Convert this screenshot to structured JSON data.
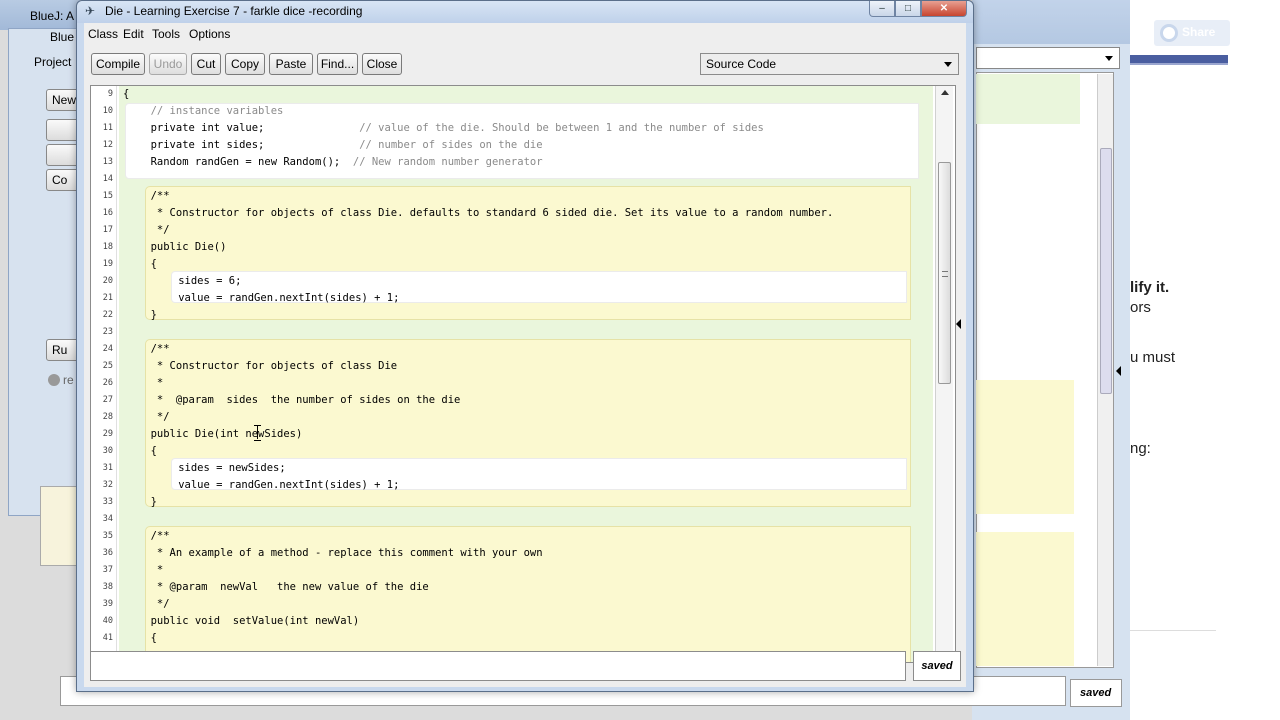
{
  "background": {
    "bluej_title_1": "BlueJ: A",
    "bluej_title_2": "Blue",
    "project_menu": "Project",
    "buttons": [
      "New",
      "Co",
      "Ru"
    ],
    "radio_label": "re",
    "right_saved": "saved",
    "browser": {
      "share_label": "Share",
      "text_lines": [
        "lify it.",
        "ors",
        "u must",
        "ng:"
      ]
    }
  },
  "window": {
    "title": "Die - Learning Exercise 7 - farkle dice -recording",
    "controls": {
      "minimize": "–",
      "maximize": "□",
      "close": "✕"
    }
  },
  "menu": [
    "Class",
    "Edit",
    "Tools",
    "Options"
  ],
  "toolbar": {
    "buttons": [
      {
        "label": "Compile",
        "enabled": true
      },
      {
        "label": "Undo",
        "enabled": false
      },
      {
        "label": "Cut",
        "enabled": true
      },
      {
        "label": "Copy",
        "enabled": true
      },
      {
        "label": "Paste",
        "enabled": true
      },
      {
        "label": "Find...",
        "enabled": true
      },
      {
        "label": "Close",
        "enabled": true
      }
    ],
    "view_select": "Source Code"
  },
  "editor": {
    "lines": [
      {
        "n": "9",
        "code": "{",
        "indent": 0,
        "comment": false
      },
      {
        "n": "10",
        "code": "// instance variables",
        "indent": 4,
        "comment": true
      },
      {
        "n": "11",
        "code": "private int value;               // value of the die. Should be between 1 and the number of sides",
        "indent": 4,
        "comment": false
      },
      {
        "n": "12",
        "code": "private int sides;               // number of sides on the die",
        "indent": 4,
        "comment": false
      },
      {
        "n": "13",
        "code": "Random randGen = new Random();  // New random number generator",
        "indent": 4,
        "comment": false
      },
      {
        "n": "14",
        "code": "",
        "indent": 0,
        "comment": false
      },
      {
        "n": "15",
        "code": "/**",
        "indent": 4,
        "comment": false
      },
      {
        "n": "16",
        "code": " * Constructor for objects of class Die. defaults to standard 6 sided die. Set its value to a random number.",
        "indent": 4,
        "comment": false
      },
      {
        "n": "17",
        "code": " */",
        "indent": 4,
        "comment": false
      },
      {
        "n": "18",
        "code": "public Die()",
        "indent": 4,
        "comment": false
      },
      {
        "n": "19",
        "code": "{",
        "indent": 4,
        "comment": false
      },
      {
        "n": "20",
        "code": "sides = 6;",
        "indent": 8,
        "comment": false
      },
      {
        "n": "21",
        "code": "value = randGen.nextInt(sides) + 1;",
        "indent": 8,
        "comment": false
      },
      {
        "n": "22",
        "code": "}",
        "indent": 4,
        "comment": false
      },
      {
        "n": "23",
        "code": "",
        "indent": 0,
        "comment": false
      },
      {
        "n": "24",
        "code": "/**",
        "indent": 4,
        "comment": false
      },
      {
        "n": "25",
        "code": " * Constructor for objects of class Die",
        "indent": 4,
        "comment": false
      },
      {
        "n": "26",
        "code": " *",
        "indent": 4,
        "comment": false
      },
      {
        "n": "27",
        "code": " *  @param  sides  the number of sides on the die",
        "indent": 4,
        "comment": false
      },
      {
        "n": "28",
        "code": " */",
        "indent": 4,
        "comment": false
      },
      {
        "n": "29",
        "code": "public Die(int newSides)",
        "indent": 4,
        "comment": false
      },
      {
        "n": "30",
        "code": "{",
        "indent": 4,
        "comment": false
      },
      {
        "n": "31",
        "code": "sides = newSides;",
        "indent": 8,
        "comment": false
      },
      {
        "n": "32",
        "code": "value = randGen.nextInt(sides) + 1;",
        "indent": 8,
        "comment": false
      },
      {
        "n": "33",
        "code": "}",
        "indent": 4,
        "comment": false
      },
      {
        "n": "34",
        "code": "",
        "indent": 0,
        "comment": false
      },
      {
        "n": "35",
        "code": "/**",
        "indent": 4,
        "comment": false
      },
      {
        "n": "36",
        "code": " * An example of a method - replace this comment with your own",
        "indent": 4,
        "comment": false
      },
      {
        "n": "37",
        "code": " *",
        "indent": 4,
        "comment": false
      },
      {
        "n": "38",
        "code": " * @param  newVal   the new value of the die",
        "indent": 4,
        "comment": false
      },
      {
        "n": "39",
        "code": " */",
        "indent": 4,
        "comment": false
      },
      {
        "n": "40",
        "code": "public void  setValue(int newVal)",
        "indent": 4,
        "comment": false
      },
      {
        "n": "41",
        "code": "{",
        "indent": 4,
        "comment": false
      }
    ]
  },
  "status": {
    "message": "",
    "saved": "saved"
  },
  "colors": {
    "class_scope": "#eaf6dc",
    "method_scope": "#fbf9d0",
    "comment": "#8a8a8a"
  }
}
